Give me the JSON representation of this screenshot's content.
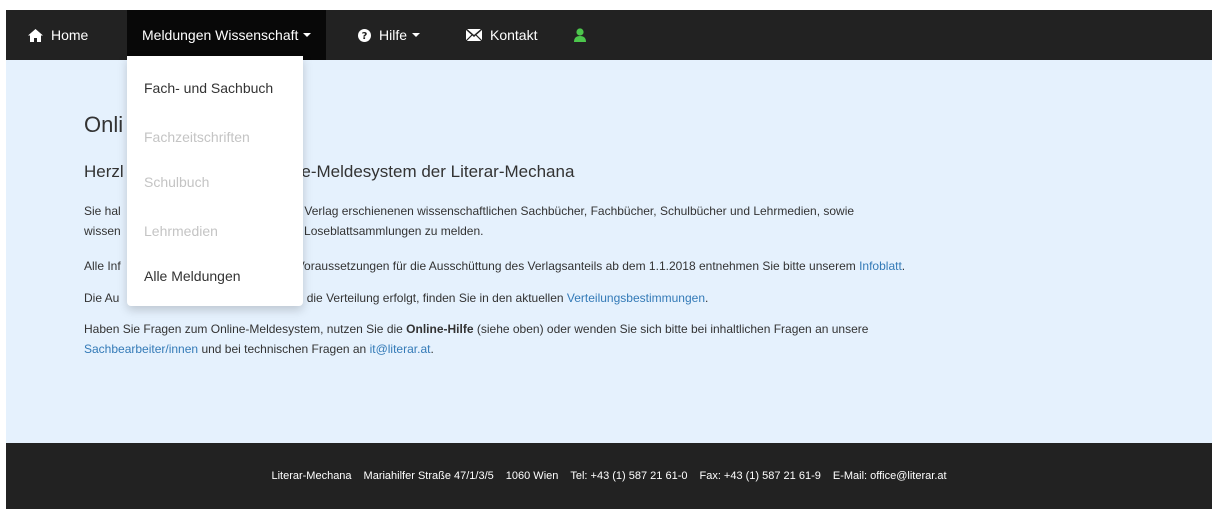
{
  "nav": {
    "home": "Home",
    "meldungen": "Meldungen Wissenschaft",
    "hilfe": "Hilfe",
    "kontakt": "Kontakt",
    "icons": [
      "home-icon",
      "question-icon",
      "envelope-icon",
      "user-icon"
    ],
    "user_icon_color": "#4cc64c"
  },
  "dropdown": {
    "items": [
      {
        "label": "Fach- und Sachbuch"
      },
      {
        "label": "Fachzeitschriften"
      },
      {
        "label": "Schulbuch"
      },
      {
        "label": "Lehrmedien"
      },
      {
        "label": "Alle Meldungen"
      }
    ]
  },
  "main": {
    "title": "Onli",
    "subtitle_prefix": "Herzl",
    "subtitle_rest": "Online-Meldesystem der Literar-Mechana",
    "p1": {
      "prefix_line1": "Sie hal",
      "rest_line1": "in Ihrem Verlag erschienenen wissenschaftlichen Sachbücher, Fachbücher, Schulbücher und Lehrmedien, sowie",
      "prefix_line2": "wissen",
      "rest_line2": "n und Loseblattsammlungen zu melden."
    },
    "p2": {
      "prefix": "Alle Inf",
      "rest": "ten Voraussetzungen für die Ausschüttung des Verlagsanteils ab dem 1.1.2018 entnehmen Sie bitte unserem",
      "link": "Infoblatt",
      "end": "."
    },
    "p3": {
      "prefix": "Die Au",
      "rest": "nen die Verteilung erfolgt, finden Sie in den aktuellen",
      "link": "Verteilungsbestimmungen",
      "end": "."
    },
    "p4": {
      "t1": "Haben Sie Fragen zum Online-Meldesystem, nutzen Sie die",
      "bold": "Online-Hilfe",
      "t2": "(siehe oben) oder wenden Sie sich bitte bei inhaltlichen Fragen an unsere",
      "link1": "Sachbearbeiter/innen",
      "t3": "und bei technischen Fragen an",
      "link2": "it@literar.at",
      "end": "."
    }
  },
  "footer": {
    "org": "Literar-Mechana",
    "street": "Mariahilfer Straße 47/1/3/5",
    "city": "1060 Wien",
    "tel": "Tel: +43 (1) 587 21 61-0",
    "fax": "Fax: +43 (1) 587 21 61-9",
    "email": "E-Mail: office@literar.at"
  }
}
